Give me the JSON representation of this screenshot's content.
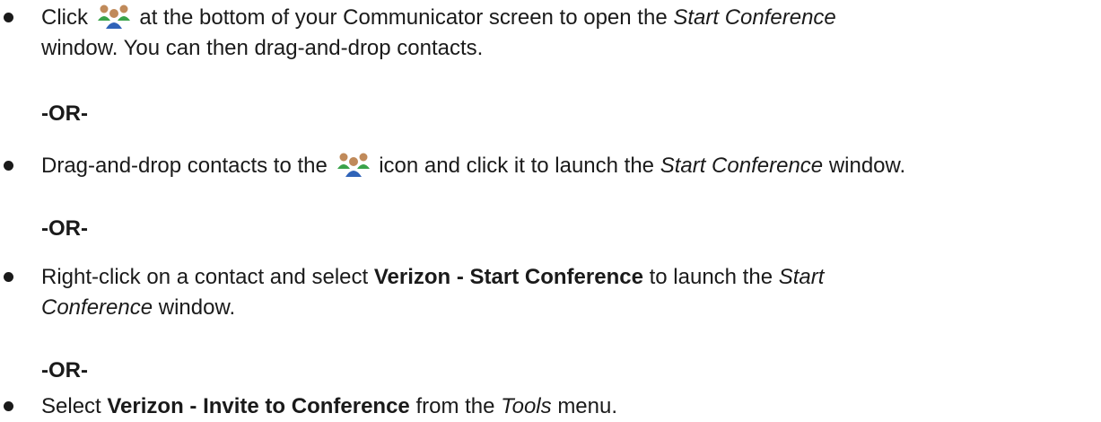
{
  "bullets": [
    {
      "before_icon": "Click",
      "after_icon": "at the bottom of your Communicator screen to open the",
      "window_name": "Start Conference",
      "line2": "window. You can then drag-and-drop contacts.",
      "icon": "conference-people-icon"
    },
    {
      "before_icon": "Drag-and-drop contacts to the",
      "after_icon": "icon and click it to launch the",
      "window_name": "Start Conference",
      "end": "window.",
      "icon": "conference-people-icon"
    },
    {
      "before": "Right-click on a contact and select",
      "bold": "Verizon - Start Conference",
      "middle": "to launch the",
      "italic_a": "Start",
      "italic_b": "Conference",
      "end": "window."
    },
    {
      "before": "Select",
      "bold": "Verizon - Invite to Conference",
      "middle": "from the",
      "italic": "Tools",
      "end": "menu."
    }
  ],
  "separators": [
    "-OR-",
    "-OR-",
    "-OR-"
  ],
  "colors": {
    "text": "#1a1a1a",
    "icon_green": "#3aa34a",
    "icon_blue": "#2f63b8",
    "icon_skin": "#c08a5a"
  }
}
